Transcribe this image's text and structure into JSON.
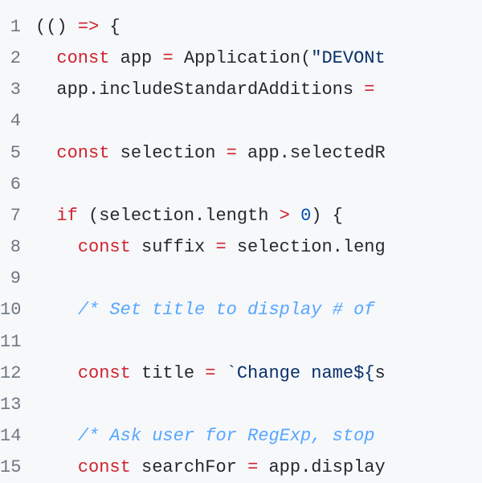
{
  "lines": [
    {
      "n": 1,
      "tokens": [
        [
          "",
          "(() "
        ],
        [
          "op",
          "=>"
        ],
        [
          "",
          " {"
        ]
      ]
    },
    {
      "n": 2,
      "tokens": [
        [
          "",
          "  "
        ],
        [
          "kw",
          "const"
        ],
        [
          "",
          " app "
        ],
        [
          "op",
          "="
        ],
        [
          "",
          " Application("
        ],
        [
          "strlit",
          "\"DEVONt"
        ]
      ]
    },
    {
      "n": 3,
      "tokens": [
        [
          "",
          "  app.includeStandardAdditions "
        ],
        [
          "op",
          "="
        ],
        [
          "",
          " "
        ]
      ]
    },
    {
      "n": 4,
      "tokens": [
        [
          "",
          ""
        ]
      ]
    },
    {
      "n": 5,
      "tokens": [
        [
          "",
          "  "
        ],
        [
          "kw",
          "const"
        ],
        [
          "",
          " selection "
        ],
        [
          "op",
          "="
        ],
        [
          "",
          " app.selectedR"
        ]
      ]
    },
    {
      "n": 6,
      "tokens": [
        [
          "",
          ""
        ]
      ]
    },
    {
      "n": 7,
      "tokens": [
        [
          "",
          "  "
        ],
        [
          "kw",
          "if"
        ],
        [
          "",
          " (selection.length "
        ],
        [
          "op",
          ">"
        ],
        [
          "",
          " "
        ],
        [
          "num",
          "0"
        ],
        [
          "",
          ") {"
        ]
      ]
    },
    {
      "n": 8,
      "tokens": [
        [
          "",
          "    "
        ],
        [
          "kw",
          "const"
        ],
        [
          "",
          " suffix "
        ],
        [
          "op",
          "="
        ],
        [
          "",
          " selection.leng"
        ]
      ]
    },
    {
      "n": 9,
      "tokens": [
        [
          "",
          ""
        ]
      ]
    },
    {
      "n": 10,
      "tokens": [
        [
          "",
          "    "
        ],
        [
          "cmt",
          "/* Set title to display # of "
        ]
      ]
    },
    {
      "n": 11,
      "tokens": [
        [
          "",
          ""
        ]
      ]
    },
    {
      "n": 12,
      "tokens": [
        [
          "",
          "    "
        ],
        [
          "kw",
          "const"
        ],
        [
          "",
          " title "
        ],
        [
          "op",
          "="
        ],
        [
          "",
          " "
        ],
        [
          "tmpl",
          "`Change name$"
        ],
        [
          "tmpl",
          "{"
        ],
        [
          "",
          "s"
        ]
      ]
    },
    {
      "n": 13,
      "tokens": [
        [
          "",
          ""
        ]
      ]
    },
    {
      "n": 14,
      "tokens": [
        [
          "",
          "    "
        ],
        [
          "cmt",
          "/* Ask user for RegExp, stop "
        ]
      ]
    },
    {
      "n": 15,
      "tokens": [
        [
          "",
          "    "
        ],
        [
          "kw",
          "const"
        ],
        [
          "",
          " searchFor "
        ],
        [
          "op",
          "="
        ],
        [
          "",
          " app.display"
        ]
      ]
    }
  ]
}
